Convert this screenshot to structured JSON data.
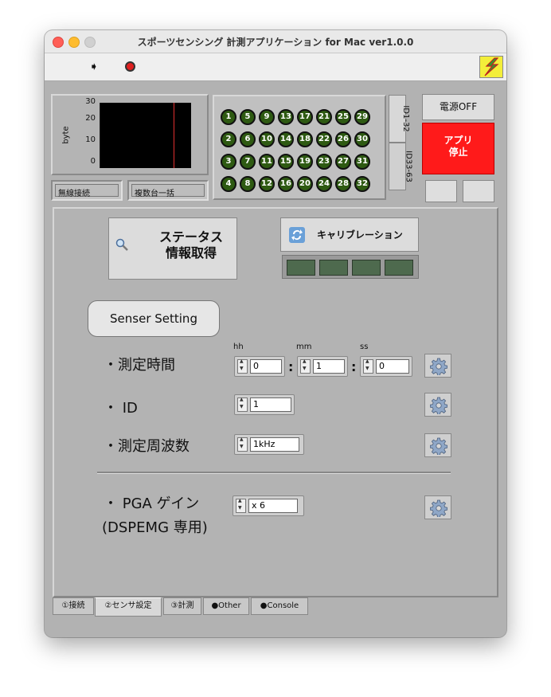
{
  "window": {
    "title": "スポーツセンシング 計測アプリケーション for Mac ver1.0.0"
  },
  "graph": {
    "ylabel": "byte",
    "yticks": [
      "30",
      "20",
      "10",
      "0"
    ]
  },
  "status_fields": {
    "wireless": "無線接続",
    "multi": "複数台一括"
  },
  "id_grid": {
    "numbers": [
      1,
      5,
      9,
      13,
      17,
      21,
      25,
      29,
      2,
      6,
      10,
      14,
      18,
      22,
      26,
      30,
      3,
      7,
      11,
      15,
      19,
      23,
      27,
      31,
      4,
      8,
      12,
      16,
      20,
      24,
      28,
      32
    ],
    "tab1": "ID1-32",
    "tab2": "ID33-63"
  },
  "controls": {
    "power_off": "電源OFF",
    "app_stop_line1": "アプリ",
    "app_stop_line2": "停止"
  },
  "actions": {
    "status_line1": "ステータス",
    "status_line2": "情報取得",
    "calibration": "キャリブレーション"
  },
  "settings": {
    "title": "Senser Setting",
    "time_label": "・測定時間",
    "hh": "hh",
    "mm": "mm",
    "ss": "ss",
    "hh_value": "0",
    "mm_value": "1",
    "ss_value": "0",
    "id_label": "・ ID",
    "id_value": "1",
    "freq_label": "・測定周波数",
    "freq_value": "1kHz",
    "pga_label_line1": "・ PGA ゲイン",
    "pga_label_line2": "(DSPEMG 専用)",
    "pga_value": "x 6"
  },
  "tabs": [
    {
      "label": "①接続"
    },
    {
      "label": "②センサ設定"
    },
    {
      "label": "③計測"
    },
    {
      "label": "●Other"
    },
    {
      "label": "●Console"
    }
  ],
  "colors": {
    "window_bg": "#b2b2b2",
    "stop_red": "#ff1a1a",
    "id_green": "#2e5a12",
    "arrow_green": "#3aa82a"
  }
}
